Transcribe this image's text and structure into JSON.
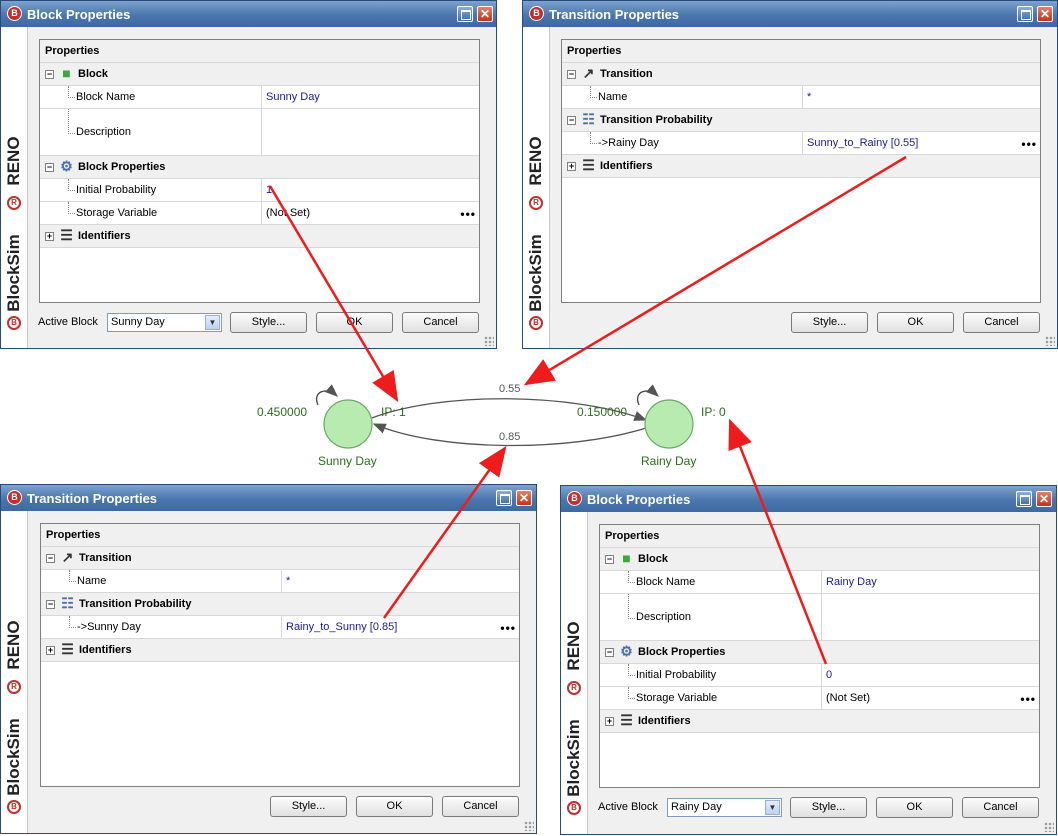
{
  "windows": {
    "block_sunny": {
      "title": "Block Properties",
      "sidebar": {
        "brand_top": "RENO",
        "brand_bottom": "BlockSim",
        "reg": "R",
        "logo": "B"
      },
      "grid_header": "Properties",
      "categories": {
        "block": "Block",
        "block_properties": "Block Properties",
        "identifiers": "Identifiers"
      },
      "block_name_label": "Block Name",
      "block_name_value": "Sunny Day",
      "description_label": "Description",
      "description_value": "",
      "initial_probability_label": "Initial Probability",
      "initial_probability_value": "1",
      "storage_variable_label": "Storage Variable",
      "storage_variable_value": "(Not Set)",
      "ellipsis": "•••",
      "active_block_label": "Active Block",
      "active_block_value": "Sunny Day",
      "buttons": {
        "style": "Style...",
        "ok": "OK",
        "cancel": "Cancel"
      }
    },
    "transition_sunny": {
      "title": "Transition Properties",
      "sidebar": {
        "brand_top": "RENO",
        "brand_bottom": "BlockSim",
        "reg": "R",
        "logo": "B"
      },
      "grid_header": "Properties",
      "categories": {
        "transition": "Transition",
        "transition_probability": "Transition Probability",
        "identifiers": "Identifiers"
      },
      "name_label": "Name",
      "name_value": "*",
      "target_label": "->Rainy Day",
      "target_value": "Sunny_to_Rainy [0.55]",
      "ellipsis": "•••",
      "buttons": {
        "style": "Style...",
        "ok": "OK",
        "cancel": "Cancel"
      }
    },
    "transition_rainy": {
      "title": "Transition Properties",
      "sidebar": {
        "brand_top": "RENO",
        "brand_bottom": "BlockSim",
        "reg": "R",
        "logo": "B"
      },
      "grid_header": "Properties",
      "categories": {
        "transition": "Transition",
        "transition_probability": "Transition Probability",
        "identifiers": "Identifiers"
      },
      "name_label": "Name",
      "name_value": "*",
      "target_label": "->Sunny Day",
      "target_value": "Rainy_to_Sunny [0.85]",
      "ellipsis": "•••",
      "buttons": {
        "style": "Style...",
        "ok": "OK",
        "cancel": "Cancel"
      }
    },
    "block_rainy": {
      "title": "Block Properties",
      "sidebar": {
        "brand_top": "RENO",
        "brand_bottom": "BlockSim",
        "reg": "R",
        "logo": "B"
      },
      "grid_header": "Properties",
      "categories": {
        "block": "Block",
        "block_properties": "Block Properties",
        "identifiers": "Identifiers"
      },
      "block_name_label": "Block Name",
      "block_name_value": "Rainy Day",
      "description_label": "Description",
      "description_value": "",
      "initial_probability_label": "Initial Probability",
      "initial_probability_value": "0",
      "storage_variable_label": "Storage Variable",
      "storage_variable_value": "(Not Set)",
      "ellipsis": "•••",
      "active_block_label": "Active Block",
      "active_block_value": "Rainy Day",
      "buttons": {
        "style": "Style...",
        "ok": "OK",
        "cancel": "Cancel"
      }
    }
  },
  "diagram": {
    "sunny": {
      "name": "Sunny Day",
      "prob": "0.450000",
      "ip": "IP: 1"
    },
    "rainy": {
      "name": "Rainy Day",
      "prob": "0.150000",
      "ip": "IP: 0"
    },
    "edge_sunny_to_rainy": "0.55",
    "edge_rainy_to_sunny": "0.85"
  },
  "colors": {
    "state_fill": "#b8ebb0",
    "state_stroke": "#5a9a5a",
    "state_text": "#2e6b1e",
    "arrow_red": "#ee1c1c",
    "title_bar": "#4a76ad",
    "value_blue": "#1a1a9a"
  }
}
